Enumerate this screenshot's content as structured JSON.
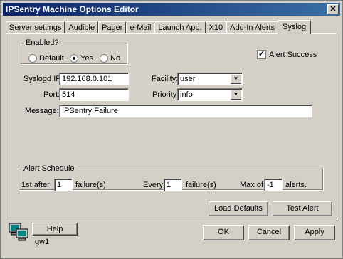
{
  "window": {
    "title": "IPSentry Machine Options Editor",
    "close_glyph": "✕"
  },
  "tabs": [
    {
      "label": "Server settings"
    },
    {
      "label": "Audible"
    },
    {
      "label": "Pager"
    },
    {
      "label": "e-Mail"
    },
    {
      "label": "Launch App."
    },
    {
      "label": "X10"
    },
    {
      "label": "Add-In Alerts"
    },
    {
      "label": "Syslog"
    }
  ],
  "enabled": {
    "legend": "Enabled?",
    "options": [
      "Default",
      "Yes",
      "No"
    ],
    "selected": "Yes"
  },
  "alert_success": {
    "label": "Alert Success",
    "checked": true
  },
  "syslog_ip": {
    "label": "Syslogd IP:",
    "value": "192.168.0.101"
  },
  "port": {
    "label": "Port:",
    "value": "514"
  },
  "facility": {
    "label": "Facility:",
    "value": "user"
  },
  "priority": {
    "label": "Priority:",
    "value": "info"
  },
  "message": {
    "label": "Message:",
    "value": "IPSentry Failure"
  },
  "schedule": {
    "legend": "Alert Schedule",
    "first_after_label": "1st after",
    "first_after_value": "1",
    "first_after_unit": "failure(s)",
    "every_label": "Every",
    "every_value": "1",
    "every_unit": "failure(s)",
    "max_of_label": "Max of",
    "max_of_value": "-1",
    "max_of_unit": "alerts."
  },
  "buttons": {
    "load_defaults": "Load Defaults",
    "test_alert": "Test Alert",
    "help": "Help",
    "ok": "OK",
    "cancel": "Cancel",
    "apply": "Apply"
  },
  "status": {
    "machine_name": "gw1",
    "icon": "computer-network-icon"
  },
  "colors": {
    "title_bar": "#0a246a",
    "face": "#d4d0c8"
  }
}
